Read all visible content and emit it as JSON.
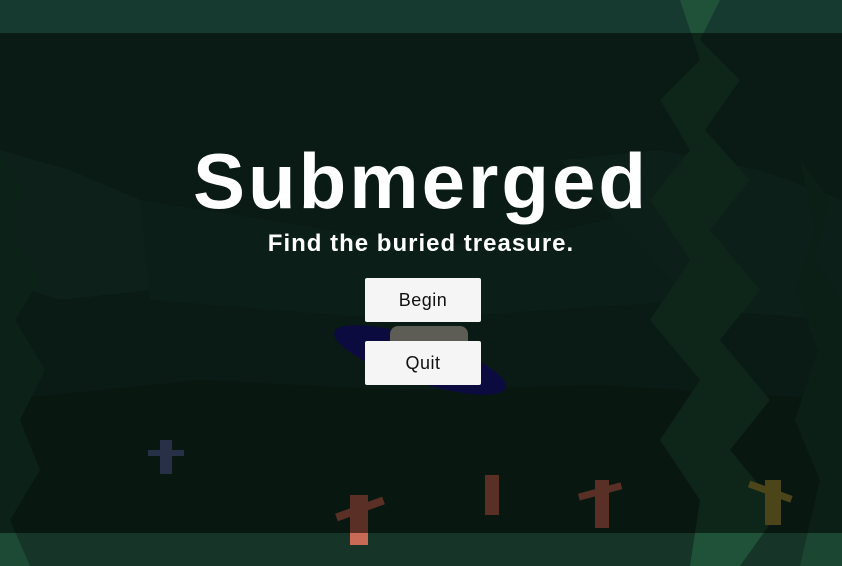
{
  "menu": {
    "title": "Submerged",
    "subtitle": "Find the buried treasure.",
    "begin_label": "Begin",
    "quit_label": "Quit"
  },
  "colors": {
    "water": "#173a30",
    "overlay": "#000000",
    "kelp": "#1c4a35",
    "text": "#ffffff",
    "button_bg": "#f5f5f5",
    "coral": "#c86a55",
    "submarine": "#1a1a8c"
  }
}
